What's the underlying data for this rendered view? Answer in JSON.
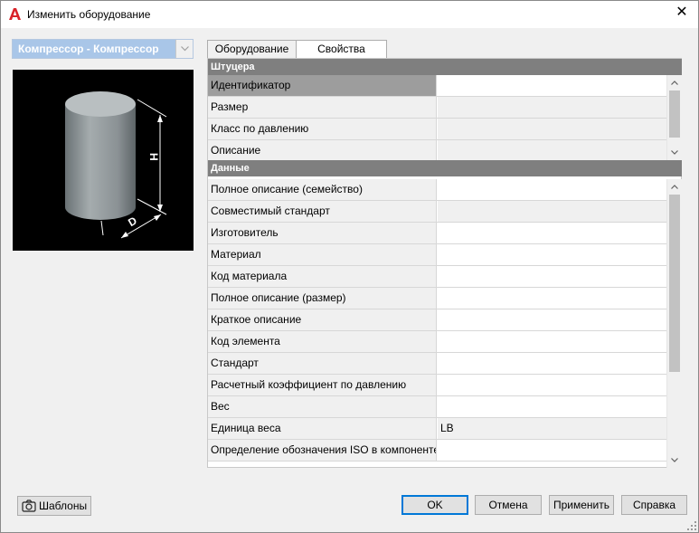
{
  "window": {
    "title": "Изменить оборудование",
    "close_glyph": "✕"
  },
  "combo": {
    "value": "Компрессор - Компрессор"
  },
  "tabs": [
    {
      "label": "Оборудование"
    },
    {
      "label": "Свойства"
    }
  ],
  "sections": {
    "fittings": {
      "header": "Штуцера",
      "rows": [
        {
          "name": "Идентификатор",
          "value": ""
        },
        {
          "name": "Размер",
          "value": ""
        },
        {
          "name": "Класс по давлению",
          "value": ""
        },
        {
          "name": "Описание",
          "value": ""
        }
      ]
    },
    "data": {
      "header": "Данные",
      "rows": [
        {
          "name": "Полное описание (семейство)",
          "value": ""
        },
        {
          "name": "Совместимый стандарт",
          "value": ""
        },
        {
          "name": "Изготовитель",
          "value": ""
        },
        {
          "name": "Материал",
          "value": ""
        },
        {
          "name": "Код материала",
          "value": ""
        },
        {
          "name": "Полное описание (размер)",
          "value": ""
        },
        {
          "name": "Краткое описание",
          "value": ""
        },
        {
          "name": "Код элемента",
          "value": ""
        },
        {
          "name": "Стандарт",
          "value": ""
        },
        {
          "name": "Расчетный коэффициент по давлению",
          "value": ""
        },
        {
          "name": "Вес",
          "value": ""
        },
        {
          "name": "Единица веса",
          "value": "LB"
        },
        {
          "name": "Определение обозначения ISO в компоненте",
          "value": ""
        }
      ]
    }
  },
  "preview": {
    "dim_h": "H",
    "dim_d": "D"
  },
  "footer": {
    "templates_label": "Шаблоны",
    "ok_label": "OK",
    "cancel_label": "Отмена",
    "apply_label": "Применить",
    "help_label": "Справка"
  },
  "colors": {
    "accent": "#0078d7",
    "section_header": "#7f7f7f",
    "selected_row": "#9d9d9d",
    "app_icon": "#d9232a"
  }
}
